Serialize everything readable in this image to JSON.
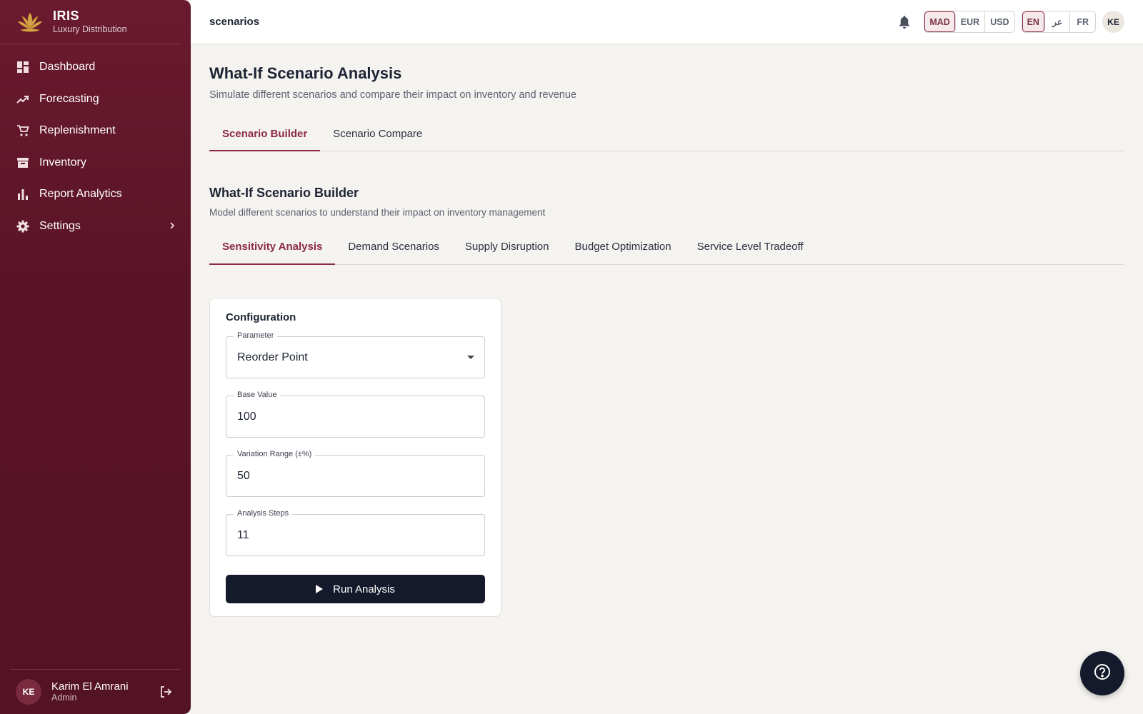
{
  "brand": {
    "title": "IRIS",
    "subtitle": "Luxury Distribution",
    "logo_icon": "lotus-icon"
  },
  "sidebar": {
    "items": [
      {
        "label": "Dashboard",
        "icon": "dashboard-icon"
      },
      {
        "label": "Forecasting",
        "icon": "trending-up-icon"
      },
      {
        "label": "Replenishment",
        "icon": "cart-icon"
      },
      {
        "label": "Inventory",
        "icon": "archive-icon"
      },
      {
        "label": "Report Analytics",
        "icon": "bar-chart-icon"
      },
      {
        "label": "Settings",
        "icon": "gear-icon",
        "has_submenu": true
      }
    ]
  },
  "user": {
    "initials": "KE",
    "name": "Karim El Amrani",
    "role": "Admin"
  },
  "topbar": {
    "breadcrumb": "scenarios",
    "currencies": [
      "MAD",
      "EUR",
      "USD"
    ],
    "selected_currency": "MAD",
    "languages": [
      "EN",
      "عر",
      "FR"
    ],
    "selected_language": "EN",
    "avatar_initials": "KE"
  },
  "page": {
    "title": "What-If Scenario Analysis",
    "subtitle": "Simulate different scenarios and compare their impact on inventory and revenue",
    "tabs": [
      "Scenario Builder",
      "Scenario Compare"
    ],
    "active_tab": "Scenario Builder"
  },
  "builder": {
    "title": "What-If Scenario Builder",
    "subtitle": "Model different scenarios to understand their impact on inventory management",
    "tabs": [
      "Sensitivity Analysis",
      "Demand Scenarios",
      "Supply Disruption",
      "Budget Optimization",
      "Service Level Tradeoff"
    ],
    "active_tab": "Sensitivity Analysis"
  },
  "config": {
    "title": "Configuration",
    "parameter": {
      "label": "Parameter",
      "value": "Reorder Point"
    },
    "base_value": {
      "label": "Base Value",
      "value": "100"
    },
    "variation": {
      "label": "Variation Range (±%)",
      "value": "50"
    },
    "steps": {
      "label": "Analysis Steps",
      "value": "11"
    },
    "run_label": "Run Analysis"
  },
  "colors": {
    "sidebar": "#5c1528",
    "accent": "#8b2a44",
    "button": "#141a2b"
  }
}
